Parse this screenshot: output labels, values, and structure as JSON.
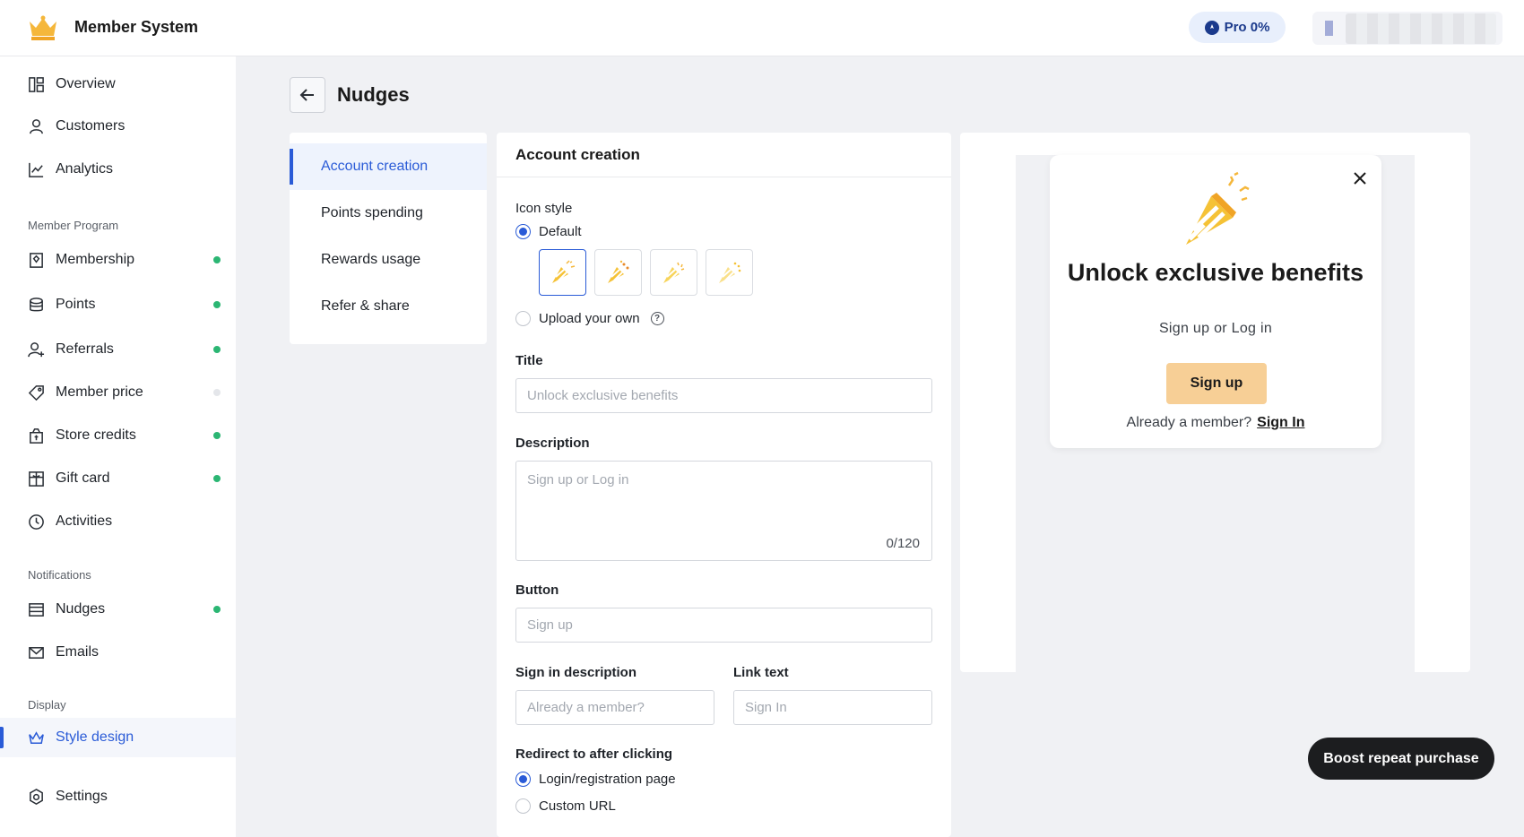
{
  "app": {
    "title": "Member System",
    "pro_badge": "Pro 0%"
  },
  "sidebar": {
    "top_items": [
      {
        "label": "Overview",
        "icon": "overview-icon"
      },
      {
        "label": "Customers",
        "icon": "person-icon"
      },
      {
        "label": "Analytics",
        "icon": "chart-line-icon"
      }
    ],
    "section_member_program": "Member Program",
    "member_items": [
      {
        "label": "Membership",
        "icon": "badge-icon",
        "status": "on"
      },
      {
        "label": "Points",
        "icon": "coins-icon",
        "status": "on"
      },
      {
        "label": "Referrals",
        "icon": "add-user-icon",
        "status": "on"
      },
      {
        "label": "Member price",
        "icon": "tag-icon",
        "status": "off"
      },
      {
        "label": "Store credits",
        "icon": "wallet-icon",
        "status": "on"
      },
      {
        "label": "Gift card",
        "icon": "gift-card-icon",
        "status": "on"
      },
      {
        "label": "Activities",
        "icon": "clock-icon"
      }
    ],
    "section_notifications": "Notifications",
    "notification_items": [
      {
        "label": "Nudges",
        "icon": "window-icon",
        "status": "on"
      },
      {
        "label": "Emails",
        "icon": "mail-icon"
      }
    ],
    "section_display": "Display",
    "display_items": [
      {
        "label": "Style design",
        "icon": "crown-icon",
        "active": true
      }
    ],
    "settings_label": "Settings"
  },
  "page": {
    "title": "Nudges"
  },
  "nudge_types": [
    "Account creation",
    "Points spending",
    "Rewards usage",
    "Refer & share"
  ],
  "form": {
    "heading": "Account creation",
    "icon_style_label": "Icon style",
    "icon_default_label": "Default",
    "icon_upload_label": "Upload your own",
    "title_label": "Title",
    "title_placeholder": "Unlock exclusive benefits",
    "description_label": "Description",
    "description_placeholder": "Sign up or Log in",
    "description_counter": "0/120",
    "button_label": "Button",
    "button_placeholder": "Sign up",
    "signin_desc_label": "Sign in description",
    "signin_desc_placeholder": "Already a member?",
    "link_text_label": "Link text",
    "link_text_placeholder": "Sign In",
    "redirect_label": "Redirect to after clicking",
    "redirect_options": [
      "Login/registration page",
      "Custom URL"
    ]
  },
  "preview": {
    "title": "Unlock exclusive benefits",
    "description": "Sign up or Log in",
    "button": "Sign up",
    "signin_text": "Already a member?",
    "signin_link": "Sign In",
    "button_color": "#f7cf96"
  },
  "boost_button": "Boost repeat purchase",
  "colors": {
    "accent": "#2a5bd7",
    "status_on": "#2bb673"
  }
}
